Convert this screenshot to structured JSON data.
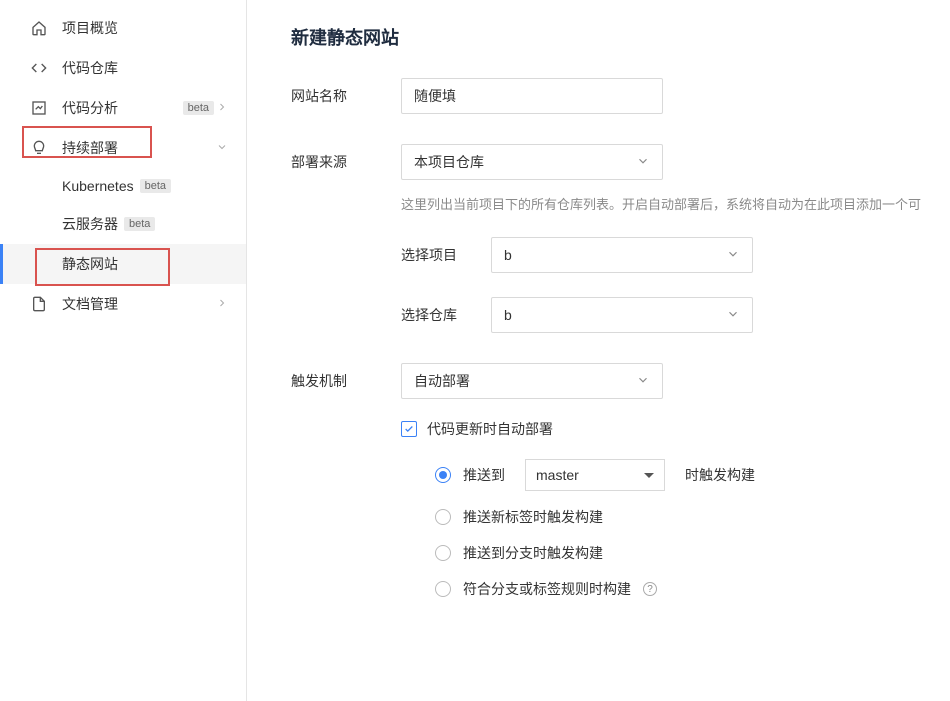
{
  "sidebar": {
    "items": [
      {
        "icon": "home",
        "label": "项目概览"
      },
      {
        "icon": "code",
        "label": "代码仓库"
      },
      {
        "icon": "analysis",
        "label": "代码分析",
        "badge": "beta",
        "chevron": "right"
      },
      {
        "icon": "deploy",
        "label": "持续部署",
        "chevron": "down",
        "expanded": true,
        "children": [
          {
            "label": "Kubernetes",
            "badge": "beta"
          },
          {
            "label": "云服务器",
            "badge": "beta"
          },
          {
            "label": "静态网站",
            "active": true
          }
        ]
      },
      {
        "icon": "doc",
        "label": "文档管理",
        "chevron": "right"
      }
    ]
  },
  "page": {
    "title": "新建静态网站",
    "fields": {
      "siteName": {
        "label": "网站名称",
        "value": "随便填"
      },
      "deploySource": {
        "label": "部署来源",
        "value": "本项目仓库",
        "helper": "这里列出当前项目下的所有仓库列表。开启自动部署后，系统将自动为在此项目添加一个可"
      },
      "selectProject": {
        "label": "选择项目",
        "value": "b"
      },
      "selectRepo": {
        "label": "选择仓库",
        "value": "b"
      },
      "trigger": {
        "label": "触发机制",
        "value": "自动部署"
      },
      "autoDeployCheckbox": {
        "label": "代码更新时自动部署",
        "checked": true
      },
      "triggerOptions": {
        "pushTo": {
          "prefix": "推送到",
          "branch": "master",
          "suffix": "时触发构建",
          "checked": true
        },
        "pushTag": {
          "label": "推送新标签时触发构建"
        },
        "pushBranch": {
          "label": "推送到分支时触发构建"
        },
        "matchRule": {
          "label": "符合分支或标签规则时构建"
        }
      }
    }
  }
}
